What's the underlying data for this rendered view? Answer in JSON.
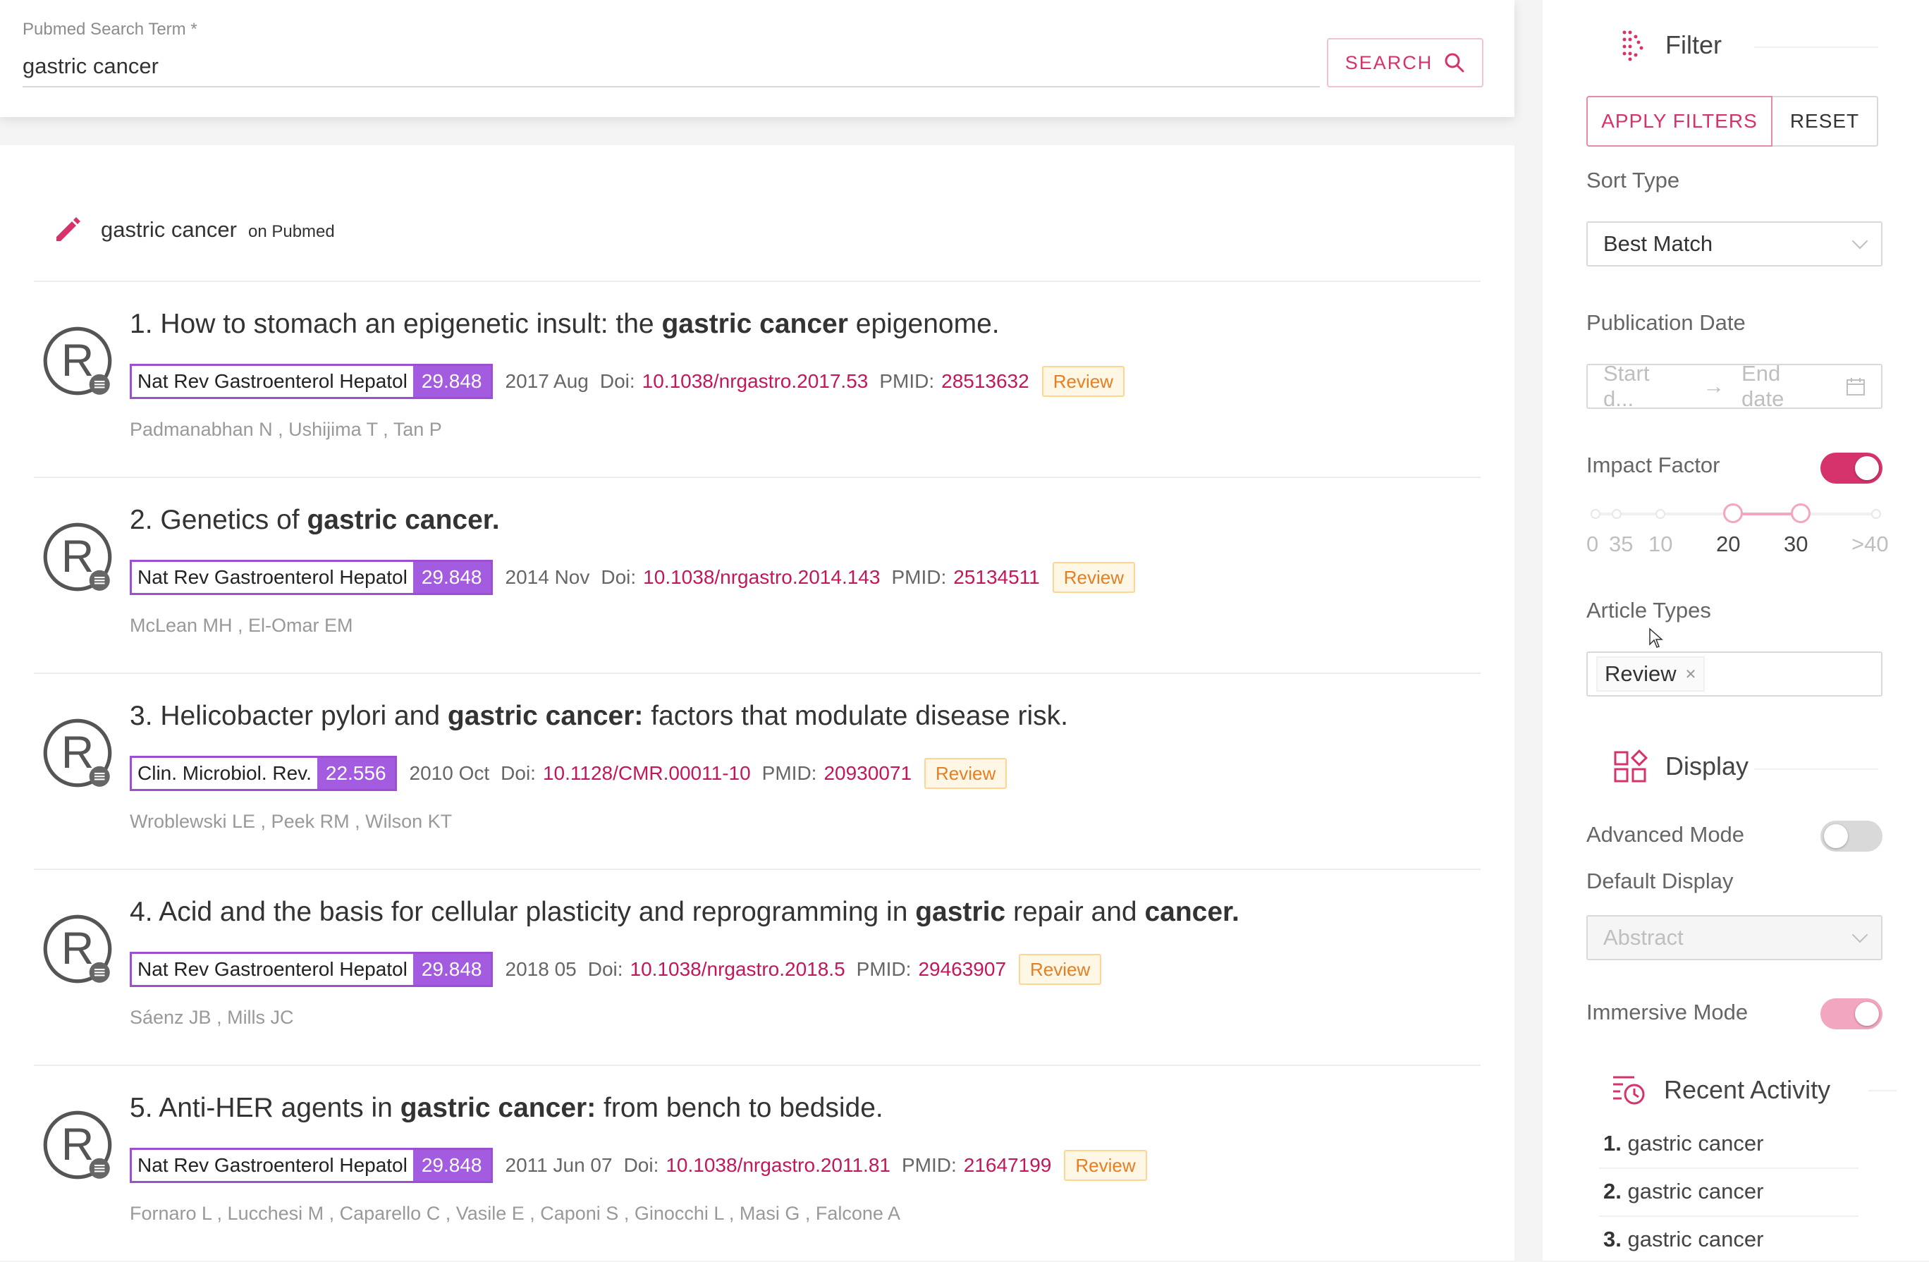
{
  "search": {
    "label": "Pubmed Search Term *",
    "value": "gastric cancer",
    "button_label": "SEARCH"
  },
  "query": {
    "term": "gastric cancer",
    "source": "on Pubmed"
  },
  "articles": [
    {
      "title_parts": [
        {
          "text": "1. How to stomach an epigenetic insult: the ",
          "bold": false
        },
        {
          "text": "gastric cancer",
          "bold": true
        },
        {
          "text": " epigenome.",
          "bold": false
        }
      ],
      "journal": "Nat Rev Gastroenterol Hepatol",
      "impact": "29.848",
      "date": "2017 Aug",
      "doi_label": "Doi:",
      "doi": "10.1038/nrgastro.2017.53",
      "pmid_label": "PMID:",
      "pmid": "28513632",
      "type": "Review",
      "authors": "Padmanabhan N , Ushijima T , Tan P"
    },
    {
      "title_parts": [
        {
          "text": "2. Genetics of ",
          "bold": false
        },
        {
          "text": "gastric cancer.",
          "bold": true
        }
      ],
      "journal": "Nat Rev Gastroenterol Hepatol",
      "impact": "29.848",
      "date": "2014 Nov",
      "doi_label": "Doi:",
      "doi": "10.1038/nrgastro.2014.143",
      "pmid_label": "PMID:",
      "pmid": "25134511",
      "type": "Review",
      "authors": "McLean MH , El-Omar EM"
    },
    {
      "title_parts": [
        {
          "text": "3. Helicobacter pylori and ",
          "bold": false
        },
        {
          "text": "gastric cancer:",
          "bold": true
        },
        {
          "text": " factors that modulate disease risk.",
          "bold": false
        }
      ],
      "journal": "Clin. Microbiol. Rev.",
      "impact": "22.556",
      "date": "2010 Oct",
      "doi_label": "Doi:",
      "doi": "10.1128/CMR.00011-10",
      "pmid_label": "PMID:",
      "pmid": "20930071",
      "type": "Review",
      "authors": "Wroblewski LE , Peek RM , Wilson KT"
    },
    {
      "title_parts": [
        {
          "text": "4. Acid and the basis for cellular plasticity and reprogramming in ",
          "bold": false
        },
        {
          "text": "gastric",
          "bold": true
        },
        {
          "text": " repair and ",
          "bold": false
        },
        {
          "text": "cancer.",
          "bold": true
        }
      ],
      "journal": "Nat Rev Gastroenterol Hepatol",
      "impact": "29.848",
      "date": "2018 05",
      "doi_label": "Doi:",
      "doi": "10.1038/nrgastro.2018.5",
      "pmid_label": "PMID:",
      "pmid": "29463907",
      "type": "Review",
      "authors": "Sáenz JB , Mills JC"
    },
    {
      "title_parts": [
        {
          "text": "5. Anti-HER agents in ",
          "bold": false
        },
        {
          "text": "gastric cancer:",
          "bold": true
        },
        {
          "text": " from bench to bedside.",
          "bold": false
        }
      ],
      "journal": "Nat Rev Gastroenterol Hepatol",
      "impact": "29.848",
      "date": "2011 Jun 07",
      "doi_label": "Doi:",
      "doi": "10.1038/nrgastro.2011.81",
      "pmid_label": "PMID:",
      "pmid": "21647199",
      "type": "Review",
      "authors": "Fornaro L , Lucchesi M , Caparello C , Vasile E , Caponi S , Ginocchi L , Masi G , Falcone A"
    }
  ],
  "sidebar": {
    "filter": {
      "title": "Filter",
      "icon": "filter-icon",
      "apply_label": "APPLY FILTERS",
      "reset_label": "RESET",
      "sort_label": "Sort Type",
      "sort_value": "Best Match",
      "pubdate_label": "Publication Date",
      "start_placeholder": "Start d...",
      "end_placeholder": "End date",
      "impact_label": "Impact Factor",
      "impact_enabled": true,
      "impact_marks": [
        "0",
        "35",
        "10",
        "20",
        "30",
        ">40"
      ],
      "impact_range": [
        20,
        30
      ],
      "article_types_label": "Article Types",
      "article_types": [
        "Review"
      ]
    },
    "display": {
      "title": "Display",
      "icon": "grid-icon",
      "advanced_label": "Advanced Mode",
      "advanced_enabled": false,
      "default_display_label": "Default Display",
      "default_display_value": "Abstract",
      "immersive_label": "Immersive Mode",
      "immersive_enabled": true
    },
    "recent": {
      "title": "Recent Activity",
      "icon": "history-icon",
      "items": [
        {
          "num": "1.",
          "text": "gastric cancer"
        },
        {
          "num": "2.",
          "text": "gastric cancer"
        },
        {
          "num": "3.",
          "text": "gastric cancer"
        }
      ]
    }
  },
  "colors": {
    "accent": "#d6336c",
    "journal_border": "#9c4fd1",
    "impact_bg": "#a35be0",
    "review_tag": "#e67e22"
  }
}
